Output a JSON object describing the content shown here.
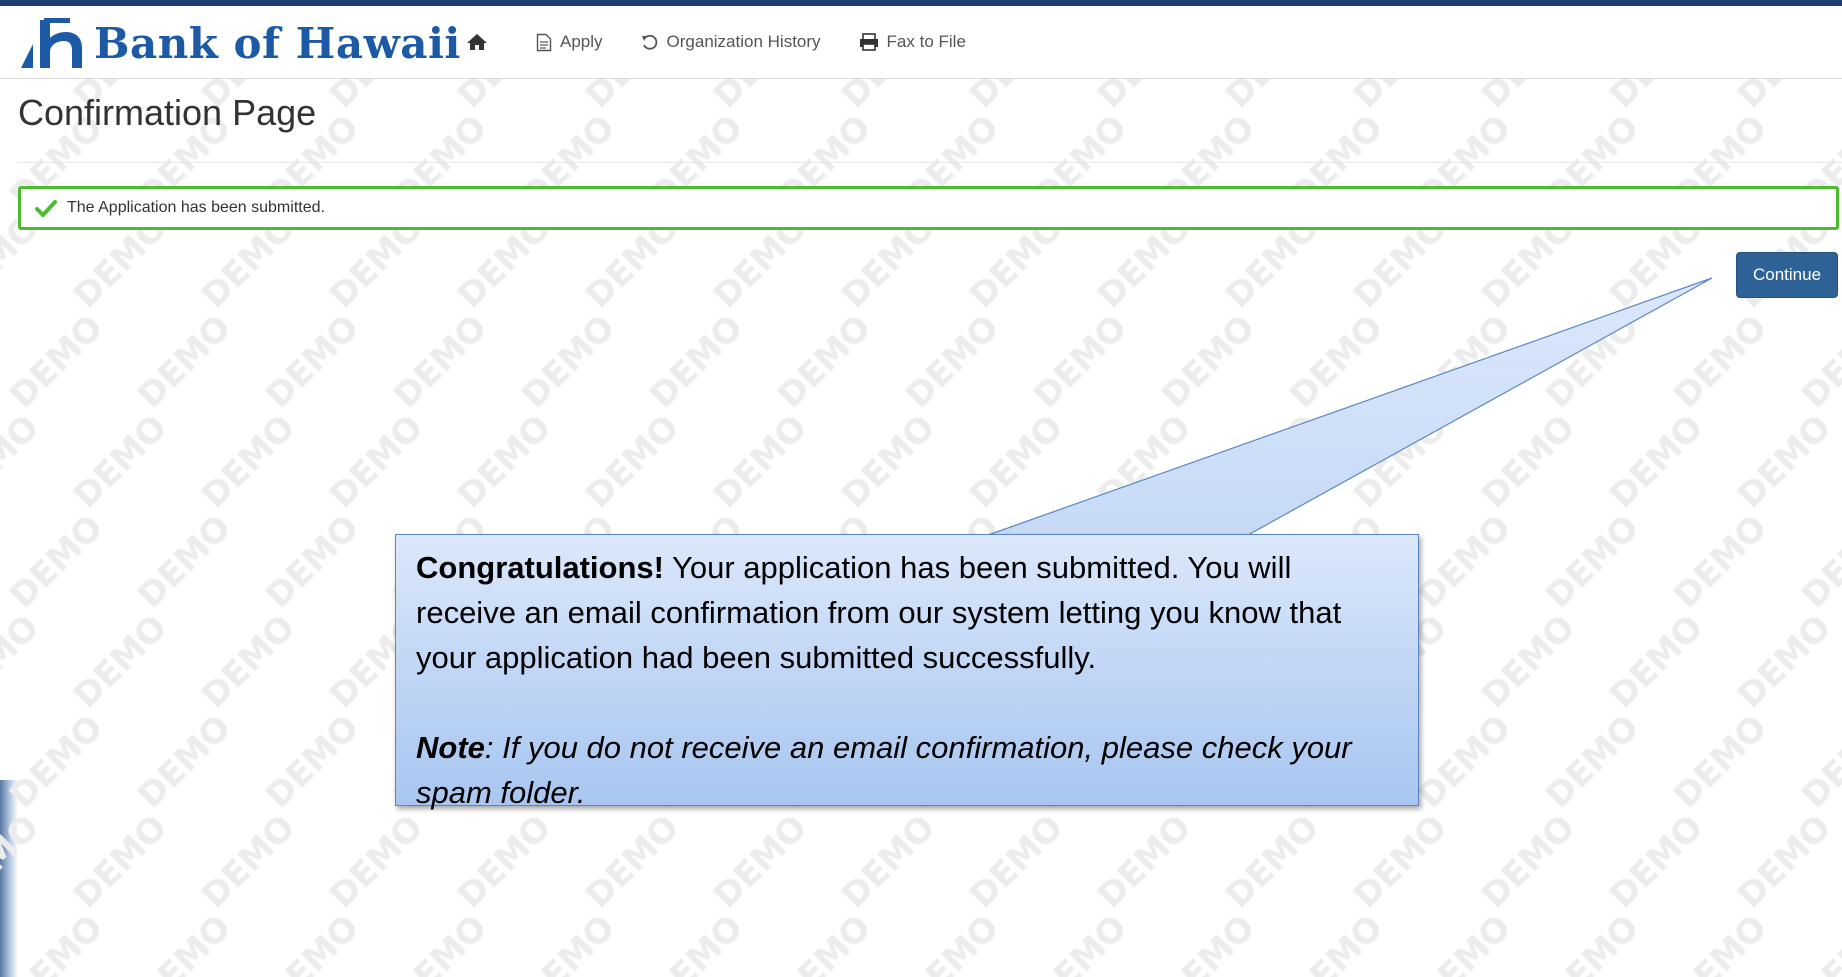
{
  "app": {
    "brand_name": "Bank of Hawaii"
  },
  "nav": {
    "home_icon": "home-icon",
    "items": [
      {
        "label": "Apply",
        "icon": "document-icon"
      },
      {
        "label": "Organization History",
        "icon": "history-icon"
      },
      {
        "label": "Fax to File",
        "icon": "fax-icon"
      }
    ]
  },
  "page": {
    "title": "Confirmation Page"
  },
  "alert": {
    "text": "The Application has been submitted.",
    "icon": "check-icon",
    "color": "#4cbb2f"
  },
  "buttons": {
    "continue_label": "Continue"
  },
  "callout": {
    "congrats_bold": "Congratulations!",
    "congrats_text": " Your application has been submitted. You will receive an email confirmation from our system letting you know that your application had been submitted successfully.",
    "note_bold": "Note",
    "note_text": ": If you do not receive an email confirmation, please check your spam folder."
  },
  "watermark": {
    "text": "DEMO"
  },
  "colors": {
    "brand_blue": "#1d5aa5",
    "button_blue": "#2f6296",
    "success_green": "#4cbb2f"
  }
}
